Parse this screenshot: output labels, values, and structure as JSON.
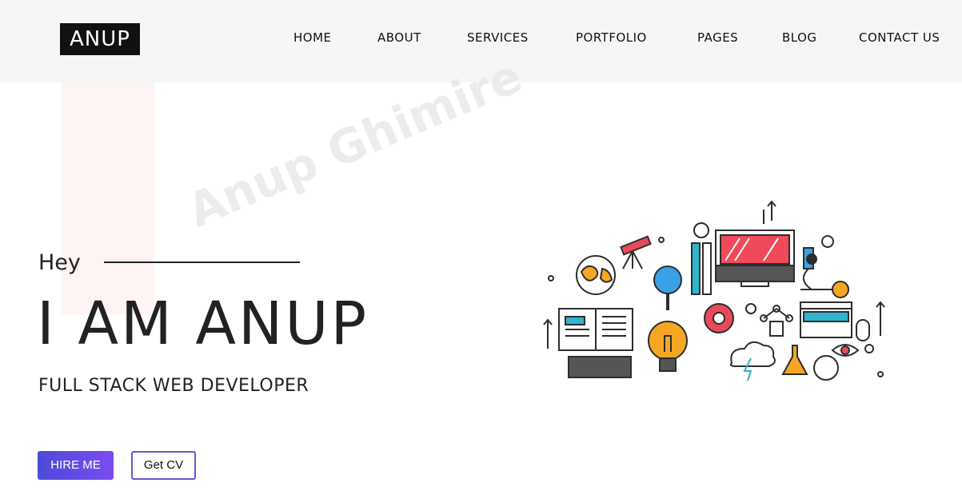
{
  "header": {
    "logo": "ANUP",
    "nav": [
      "HOME",
      "ABOUT",
      "SERVICES",
      "PORTFOLIO",
      "PAGES",
      "BLOG",
      "CONTACT US"
    ]
  },
  "hero": {
    "watermark": "Anup Ghimire",
    "greeting": "Hey",
    "title": "I AM ANUP",
    "subtitle": "FULL STACK WEB DEVELOPER",
    "hire_button": "HIRE ME",
    "cv_button": "Get CV"
  },
  "colors": {
    "accent": "#4c4ad8",
    "accent_end": "#7b4cf0",
    "header_bg": "#f5f6f8"
  }
}
